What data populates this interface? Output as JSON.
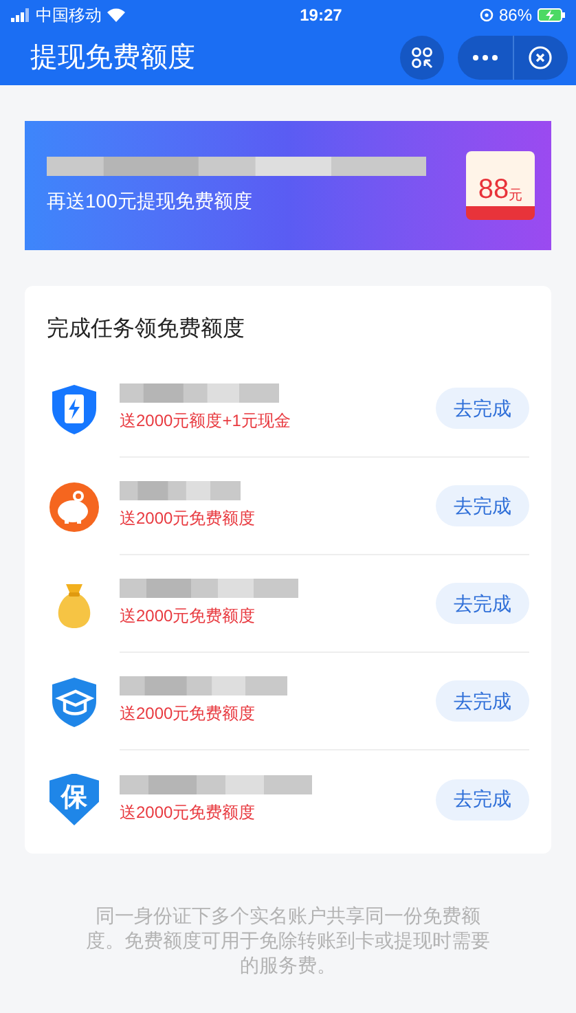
{
  "status_bar": {
    "carrier": "中国移动",
    "time": "19:27",
    "battery": "86%"
  },
  "header": {
    "title": "提现免费额度"
  },
  "banner": {
    "subtitle": "再送100元提现免费额度",
    "badge_amount": "88",
    "badge_unit": "元"
  },
  "tasks": {
    "title": "完成任务领免费额度",
    "items": [
      {
        "kind": "shield-phone",
        "reward": "送2000元额度+1元现金",
        "button": "去完成"
      },
      {
        "kind": "piggy",
        "reward": "送2000元免费额度",
        "button": "去完成"
      },
      {
        "kind": "money-bag",
        "reward": "送2000元免费额度",
        "button": "去完成"
      },
      {
        "kind": "graduation",
        "reward": "送2000元免费额度",
        "button": "去完成"
      },
      {
        "kind": "bao",
        "glyph": "保",
        "reward": "送2000元免费额度",
        "button": "去完成"
      }
    ]
  },
  "footnote": "同一身份证下多个实名账户共享同一份免费额度。免费额度可用于免除转账到卡或提现时需要的服务费。"
}
